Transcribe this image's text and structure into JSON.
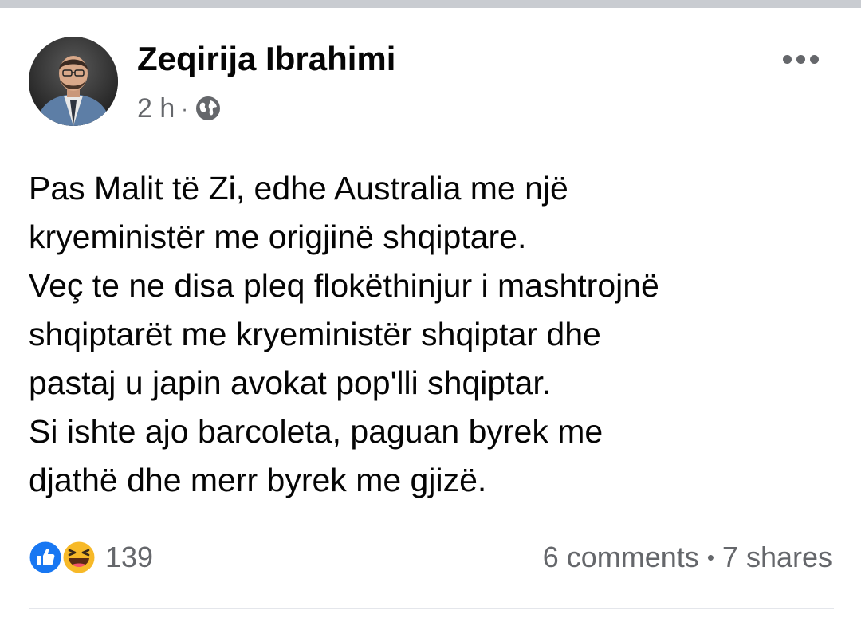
{
  "post": {
    "author": "Zeqirija Ibrahimi",
    "time": "2 h",
    "meta_separator": "·",
    "privacy_icon": "globe-icon",
    "more_icon": "more-options-icon",
    "text_lines": [
      "Pas Malit të Zi, edhe Australia me një",
      "kryeministër me origjinë shqiptare.",
      "Veç te ne disa pleq flokëthinjur i mashtrojnë",
      "shqiptarët me kryeministër shqiptar dhe",
      "pastaj u japin avokat pop'lli shqiptar.",
      "Si ishte ajo barcoleta, paguan byrek me",
      "djathë dhe merr byrek me gjizë."
    ],
    "reactions": {
      "icons": [
        "like-icon",
        "haha-icon"
      ],
      "count": "139"
    },
    "comments": "6 comments",
    "engagement_separator": "•",
    "shares": "7 shares"
  },
  "colors": {
    "text_primary": "#050505",
    "text_secondary": "#65676b",
    "like_blue": "#1877f2",
    "haha_yellow": "#f7b928",
    "divider": "#e4e6eb"
  }
}
